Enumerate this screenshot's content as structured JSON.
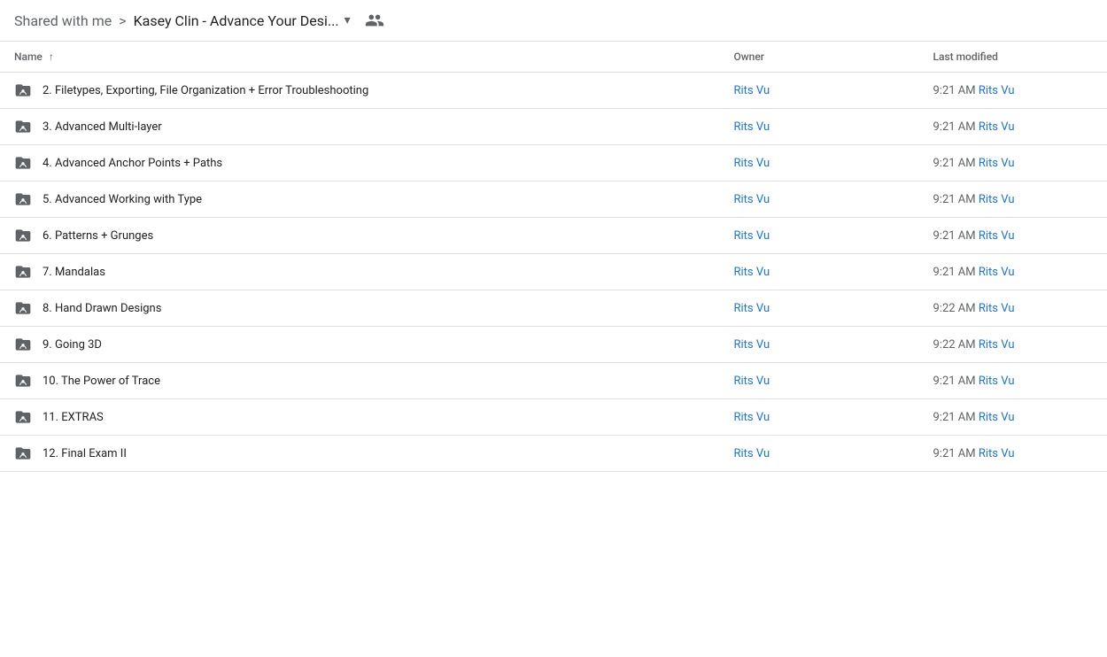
{
  "breadcrumb": {
    "shared_label": "Shared with me",
    "separator": ">",
    "current_folder": "Kasey Clin - Advance Your Desi...",
    "chevron": "▾"
  },
  "share_icon": "people-icon",
  "table": {
    "columns": {
      "name": "Name",
      "sort_icon": "↑",
      "owner": "Owner",
      "last_modified": "Last modified"
    },
    "rows": [
      {
        "id": 1,
        "name": "2. Filetypes, Exporting, File Organization + Error Troubleshooting",
        "owner": "Rits Vu",
        "time": "9:21 AM",
        "modified_owner": "Rits Vu"
      },
      {
        "id": 2,
        "name": "3. Advanced Multi-layer",
        "owner": "Rits Vu",
        "time": "9:21 AM",
        "modified_owner": "Rits Vu"
      },
      {
        "id": 3,
        "name": "4. Advanced Anchor Points + Paths",
        "owner": "Rits Vu",
        "time": "9:21 AM",
        "modified_owner": "Rits Vu"
      },
      {
        "id": 4,
        "name": "5. Advanced Working with Type",
        "owner": "Rits Vu",
        "time": "9:21 AM",
        "modified_owner": "Rits Vu"
      },
      {
        "id": 5,
        "name": "6. Patterns + Grunges",
        "owner": "Rits Vu",
        "time": "9:21 AM",
        "modified_owner": "Rits Vu"
      },
      {
        "id": 6,
        "name": "7. Mandalas",
        "owner": "Rits Vu",
        "time": "9:21 AM",
        "modified_owner": "Rits Vu"
      },
      {
        "id": 7,
        "name": "8. Hand Drawn Designs",
        "owner": "Rits Vu",
        "time": "9:22 AM",
        "modified_owner": "Rits Vu"
      },
      {
        "id": 8,
        "name": "9. Going 3D",
        "owner": "Rits Vu",
        "time": "9:22 AM",
        "modified_owner": "Rits Vu"
      },
      {
        "id": 9,
        "name": "10. The Power of Trace",
        "owner": "Rits Vu",
        "time": "9:21 AM",
        "modified_owner": "Rits Vu"
      },
      {
        "id": 10,
        "name": "11. EXTRAS",
        "owner": "Rits Vu",
        "time": "9:21 AM",
        "modified_owner": "Rits Vu"
      },
      {
        "id": 11,
        "name": "12. Final Exam II",
        "owner": "Rits Vu",
        "time": "9:21 AM",
        "modified_owner": "Rits Vu"
      }
    ]
  }
}
